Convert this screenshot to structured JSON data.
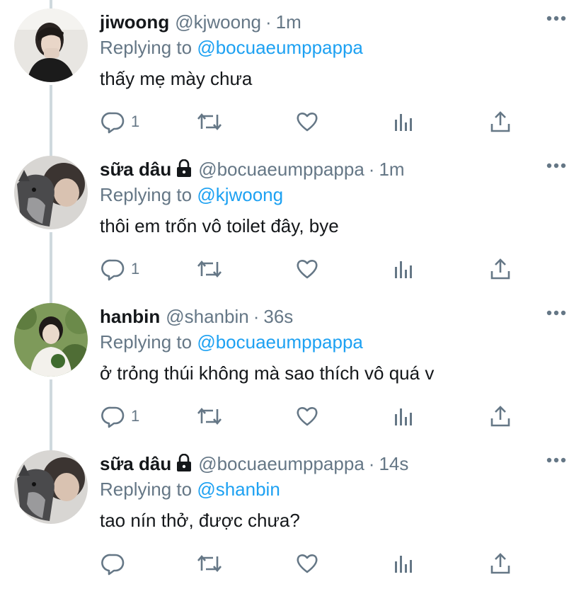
{
  "colors": {
    "text": "#14171a",
    "secondary": "#657786",
    "mention": "#1da1f2",
    "thread_line": "#cfd9de"
  },
  "tweets": [
    {
      "name": "jiwoong",
      "locked": false,
      "handle": "@kjwoong",
      "separator": "·",
      "time": "1m",
      "replying_prefix": "Replying to",
      "replying_to": "@bocuaeumppappa",
      "text": "thấy mẹ mày chưa",
      "reply_count": "1",
      "avatar_icon": "profile-photo-jiwoong"
    },
    {
      "name": "sữa dâu",
      "locked": true,
      "handle": "@bocuaeumppappa",
      "separator": "·",
      "time": "1m",
      "replying_prefix": "Replying to",
      "replying_to": "@kjwoong",
      "text": "thôi em trốn vô toilet đây, bye",
      "reply_count": "1",
      "avatar_icon": "profile-photo-sua-dau"
    },
    {
      "name": "hanbin",
      "locked": false,
      "handle": "@shanbin",
      "separator": "·",
      "time": "36s",
      "replying_prefix": "Replying to",
      "replying_to": "@bocuaeumppappa",
      "text": "ở trỏng thúi không mà sao thích vô quá v",
      "reply_count": "1",
      "avatar_icon": "profile-photo-hanbin"
    },
    {
      "name": "sữa dâu",
      "locked": true,
      "handle": "@bocuaeumppappa",
      "separator": "·",
      "time": "14s",
      "replying_prefix": "Replying to",
      "replying_to": "@shanbin",
      "text": "tao nín thở, được chưa?",
      "reply_count": "",
      "avatar_icon": "profile-photo-sua-dau"
    }
  ]
}
